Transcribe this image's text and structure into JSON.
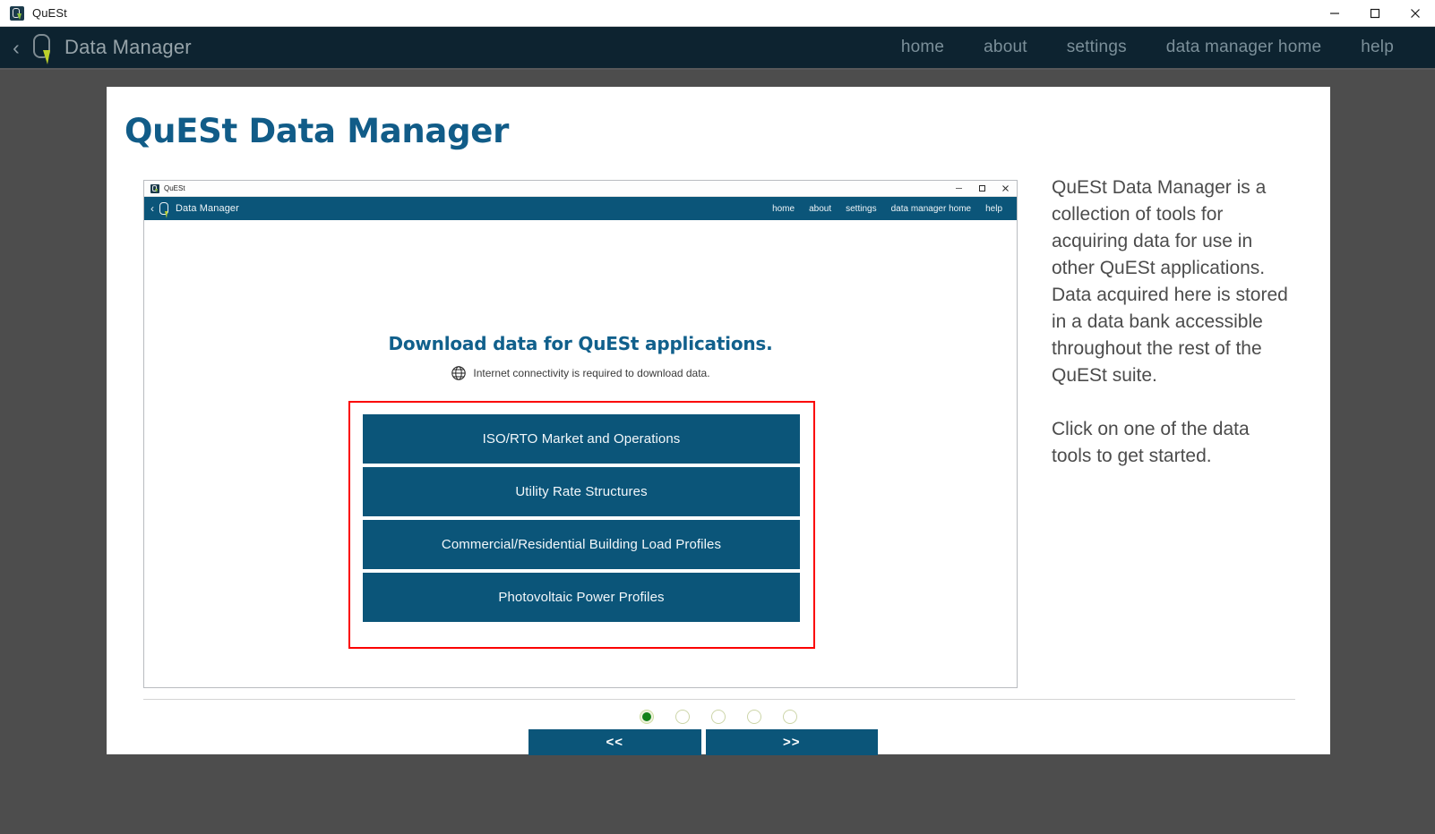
{
  "os_window": {
    "title": "QuESt",
    "app_icon": "quest-logo-icon",
    "controls": {
      "minimize": "minimize-icon",
      "maximize": "maximize-icon",
      "close": "close-icon"
    }
  },
  "app_navbar": {
    "back_glyph": "‹",
    "logo": "quest-logo-icon",
    "title": "Data Manager",
    "links": [
      {
        "label": "home"
      },
      {
        "label": "about"
      },
      {
        "label": "settings"
      },
      {
        "label": "data manager home"
      },
      {
        "label": "help"
      }
    ]
  },
  "card": {
    "title": "QuESt Data Manager"
  },
  "screenshot": {
    "titlebar": {
      "title": "QuESt",
      "app_icon": "quest-logo-icon",
      "controls": {
        "minimize": "minimize-icon",
        "maximize": "maximize-icon",
        "close": "close-icon"
      }
    },
    "navbar": {
      "back_glyph": "‹",
      "logo": "quest-logo-icon",
      "title": "Data Manager",
      "links": [
        {
          "label": "home"
        },
        {
          "label": "about"
        },
        {
          "label": "settings"
        },
        {
          "label": "data manager home"
        },
        {
          "label": "help"
        }
      ]
    },
    "heading": "Download data for QuESt applications.",
    "subtext": "Internet connectivity is required to download data.",
    "subtext_icon": "globe-icon",
    "highlight_color": "#fb0000",
    "tools": [
      {
        "label": "ISO/RTO Market and Operations"
      },
      {
        "label": "Utility Rate Structures"
      },
      {
        "label": "Commercial/Residential Building Load Profiles"
      },
      {
        "label": "Photovoltaic Power Profiles"
      }
    ]
  },
  "pager": {
    "dots": [
      {
        "state": "active"
      },
      {
        "state": "inactive"
      },
      {
        "state": "inactive"
      },
      {
        "state": "inactive"
      },
      {
        "state": "inactive"
      }
    ],
    "active_dot_color": "#14821a",
    "prev_label": "<<",
    "next_label": ">>"
  },
  "description": {
    "paragraphs": [
      "QuESt Data Manager is a collection of tools for acquiring data for use in other QuESt applications. Data acquired here is stored in a data bank accessible throughout the rest of the QuESt suite.",
      "Click on one of the data tools to get started."
    ]
  },
  "colors": {
    "navy": "#0d2330",
    "brand_blue": "#0b5579",
    "title_blue": "#115c88",
    "canvas_gray": "#4d4d4d",
    "accent_green": "#bcd02a"
  }
}
